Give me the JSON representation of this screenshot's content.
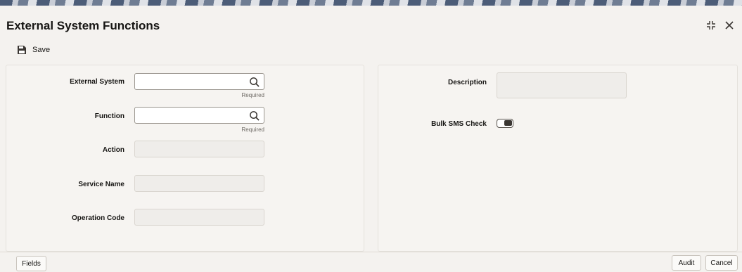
{
  "window": {
    "title": "External System Functions"
  },
  "toolbar": {
    "save_label": "Save"
  },
  "form": {
    "external_system": {
      "label": "External System",
      "value": "",
      "hint": "Required"
    },
    "function": {
      "label": "Function",
      "value": "",
      "hint": "Required"
    },
    "action": {
      "label": "Action",
      "value": ""
    },
    "service_name": {
      "label": "Service Name",
      "value": ""
    },
    "operation_code": {
      "label": "Operation Code",
      "value": ""
    },
    "description": {
      "label": "Description",
      "value": ""
    },
    "bulk_sms_check": {
      "label": "Bulk SMS Check",
      "checked": false
    }
  },
  "footer": {
    "fields_label": "Fields",
    "audit_label": "Audit",
    "cancel_label": "Cancel"
  }
}
